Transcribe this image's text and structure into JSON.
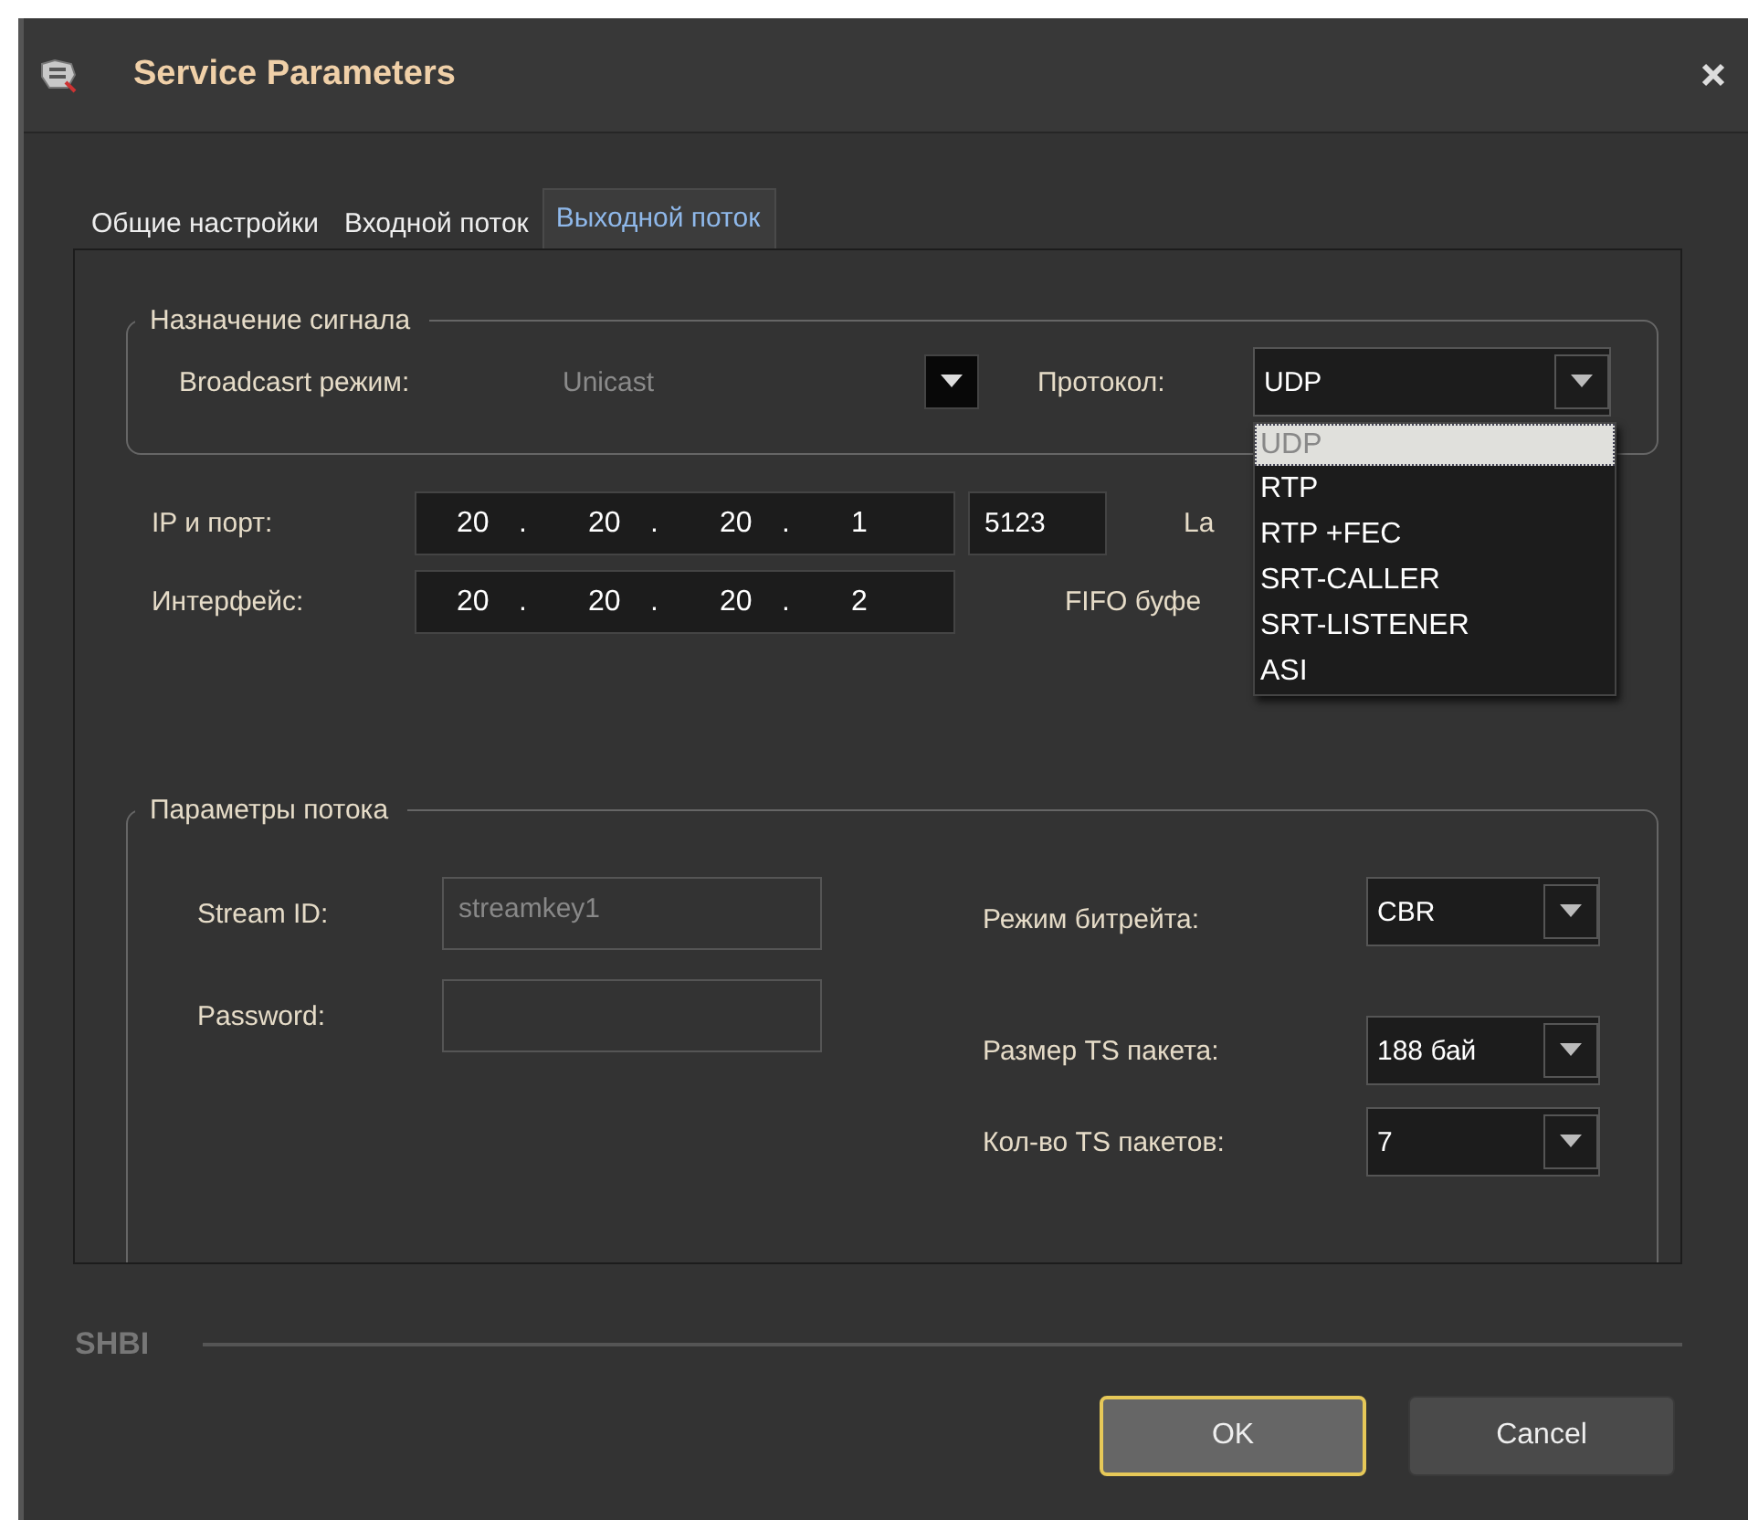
{
  "window": {
    "title": "Service Parameters"
  },
  "tabs": [
    {
      "label": "Общие настройки",
      "selected": false
    },
    {
      "label": "Входной поток",
      "selected": false
    },
    {
      "label": "Выходной поток",
      "selected": true
    }
  ],
  "signal_group": {
    "title": "Назначение сигнала",
    "broadcast_label": "Broadcasrt режим:",
    "broadcast_value": "Unicast",
    "broadcast_disabled": true,
    "protocol_label": "Протокол:",
    "protocol_value": "UDP",
    "protocol_expanded": true,
    "protocol_options": [
      {
        "label": "UDP",
        "selected": true
      },
      {
        "label": "RTP",
        "selected": false
      },
      {
        "label": "RTP +FEC",
        "selected": false
      },
      {
        "label": "SRT-CALLER",
        "selected": false
      },
      {
        "label": "SRT-LISTENER",
        "selected": false
      },
      {
        "label": "ASI",
        "selected": false
      }
    ]
  },
  "address": {
    "ip_label": "IP и порт:",
    "ip_octets": [
      "20",
      "20",
      "20",
      "1"
    ],
    "separator": ".",
    "port": "5123",
    "latency_label": "La",
    "interface_label": "Интерфейс:",
    "interface_octets": [
      "20",
      "20",
      "20",
      "2"
    ],
    "fifo_label": "FIFO буфе"
  },
  "stream_group": {
    "title": "Параметры потока",
    "stream_id_label": "Stream ID:",
    "stream_id_value": "streamkey1",
    "stream_id_disabled": true,
    "password_label": "Password:",
    "bitrate_label": "Режим битрейта:",
    "bitrate_value": "CBR",
    "ts_size_label": "Размер TS пакета:",
    "ts_size_value": "188 бай",
    "ts_count_label": "Кол-во TS пакетов:",
    "ts_count_value": "7"
  },
  "footer": {
    "brand": "SHBI",
    "buttons": [
      {
        "label": "OK",
        "focused": true
      },
      {
        "label": "Cancel",
        "focused": false
      }
    ]
  }
}
